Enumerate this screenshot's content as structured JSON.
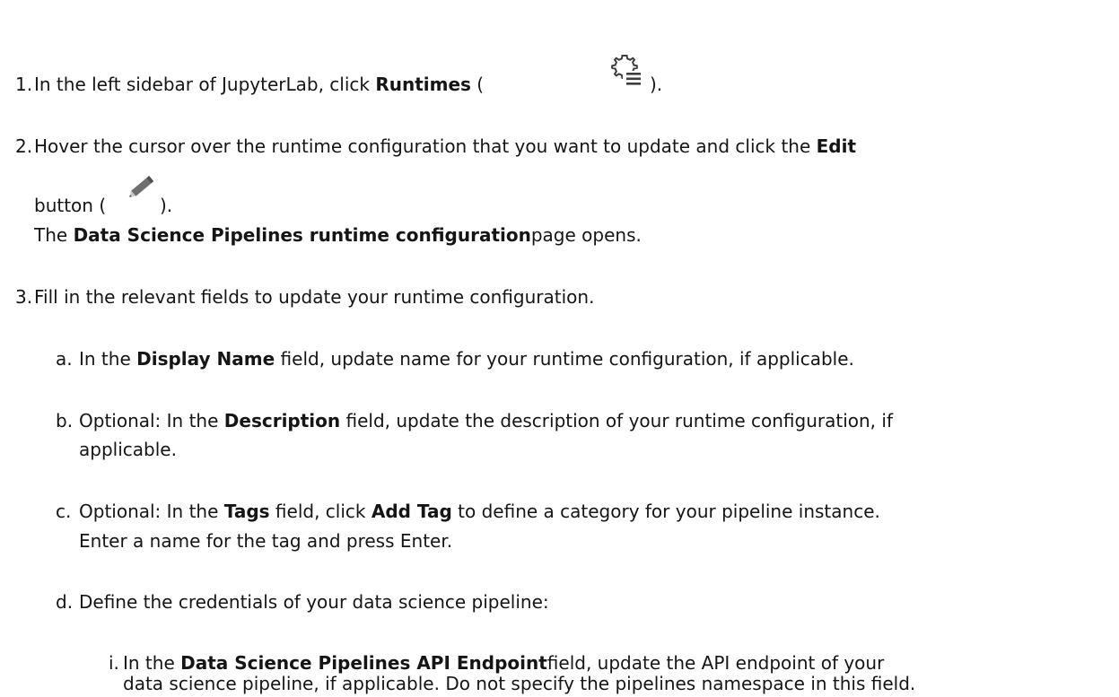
{
  "steps": [
    {
      "num": "1.",
      "pre": "In the left sidebar of JupyterLab, click ",
      "bold": "Runtimes",
      "post1": " (",
      "icon": "runtimes-gear-list-icon",
      "post2": ")."
    },
    {
      "num": "2.",
      "pre": "Hover the cursor over the runtime configuration that you want to update and click the ",
      "bold": "Edit",
      "line2_pre": "button (",
      "icon": "pencil-icon",
      "line2_post": ").",
      "line3_pre": "The ",
      "line3_bold": "Data Science Pipelines runtime configuration",
      "line3_post": "page opens."
    },
    {
      "num": "3.",
      "text": "Fill in the relevant fields to update your runtime configuration.",
      "substeps": [
        {
          "num": "a.",
          "pre": "In the ",
          "bold": "Display Name",
          "post": " field, update name for your runtime configuration, if applicable."
        },
        {
          "num": "b.",
          "pre": "Optional: In the ",
          "bold": "Description",
          "post": " field, update the description of your runtime configuration, if",
          "line2": "applicable."
        },
        {
          "num": "c.",
          "pre": "Optional: In the ",
          "bold": "Tags",
          "mid": " field, click ",
          "bold2": "Add Tag",
          "post": " to define a category for your pipeline instance.",
          "line2": "Enter a name for the tag and press Enter."
        },
        {
          "num": "d.",
          "text": "Define the credentials of your data science pipeline:",
          "substeps": [
            {
              "num": "i.",
              "pre": "In the ",
              "bold": "Data Science Pipelines API Endpoint",
              "post": "field, update the API endpoint of your",
              "line2": "data science pipeline, if applicable. Do not specify the pipelines namespace in this field."
            }
          ]
        }
      ]
    }
  ]
}
